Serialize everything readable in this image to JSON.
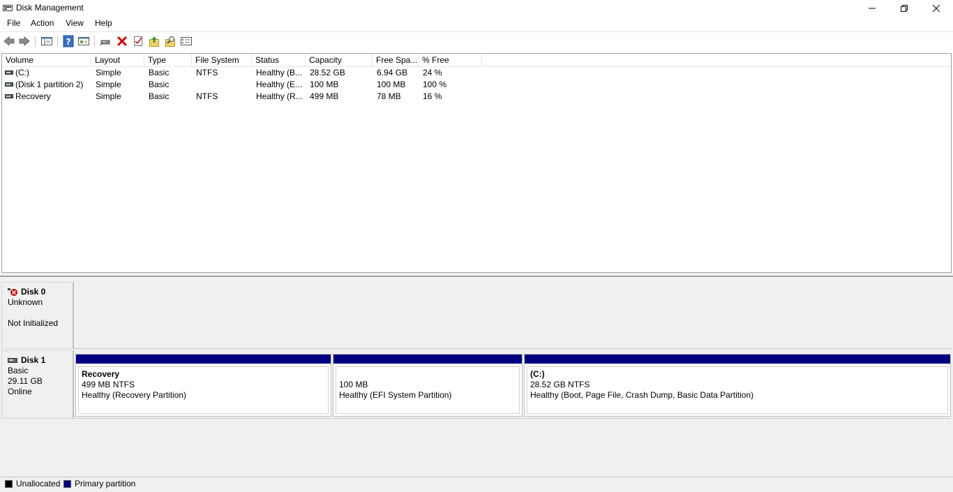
{
  "window": {
    "title": "Disk Management"
  },
  "menu": {
    "items": [
      {
        "label": "File"
      },
      {
        "label": "Action"
      },
      {
        "label": "View"
      },
      {
        "label": "Help"
      }
    ]
  },
  "toolbar": {
    "buttons": [
      "back-icon",
      "forward-icon",
      "console-tree-icon",
      "help-icon",
      "properties-icon",
      "connect-drive-icon",
      "delete-icon",
      "check-icon",
      "import-icon",
      "search-icon",
      "list-view-icon"
    ]
  },
  "volume_list": {
    "columns": [
      "Volume",
      "Layout",
      "Type",
      "File System",
      "Status",
      "Capacity",
      "Free Spa...",
      "% Free"
    ],
    "rows": [
      {
        "volume": " (C:)",
        "layout": "Simple",
        "type": "Basic",
        "fs": "NTFS",
        "status": "Healthy (B...",
        "capacity": "28.52 GB",
        "free": "6.94 GB",
        "pct": "24 %"
      },
      {
        "volume": "(Disk 1 partition 2)",
        "layout": "Simple",
        "type": "Basic",
        "fs": "",
        "status": "Healthy (E...",
        "capacity": "100 MB",
        "free": "100 MB",
        "pct": "100 %"
      },
      {
        "volume": "Recovery",
        "layout": "Simple",
        "type": "Basic",
        "fs": "NTFS",
        "status": "Healthy (R...",
        "capacity": "499 MB",
        "free": "78 MB",
        "pct": "16 %"
      }
    ]
  },
  "disks": {
    "disk0": {
      "name": "Disk 0",
      "type": "Unknown",
      "state": "Not Initialized"
    },
    "disk1": {
      "name": "Disk 1",
      "type": "Basic",
      "size": "29.11 GB",
      "state": "Online",
      "partitions": [
        {
          "name": "Recovery",
          "size": "499 MB NTFS",
          "status": "Healthy (Recovery Partition)"
        },
        {
          "name": "",
          "size": "100 MB",
          "status": "Healthy (EFI System Partition)"
        },
        {
          "name": "(C:)",
          "size": "28.52 GB NTFS",
          "status": "Healthy (Boot, Page File, Crash Dump, Basic Data Partition)"
        }
      ]
    }
  },
  "legend": {
    "unallocated": "Unallocated",
    "primary": "Primary partition",
    "colors": {
      "unallocated": "#000000",
      "primary": "#000080"
    }
  }
}
